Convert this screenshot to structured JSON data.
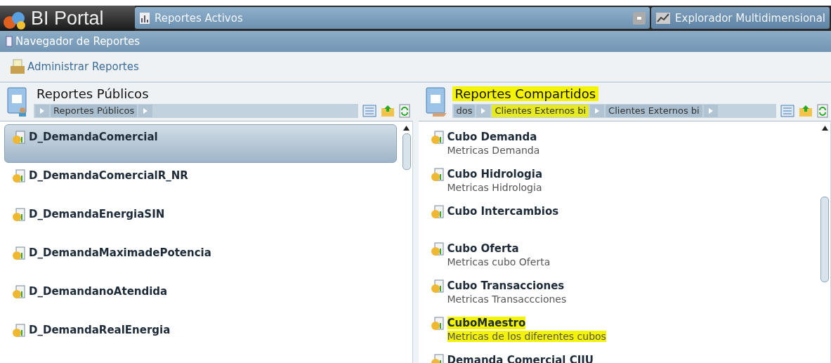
{
  "app": {
    "title": "BI Portal"
  },
  "tabs": [
    {
      "label": "Reportes Activos",
      "selected": true,
      "kind": "reports"
    },
    {
      "label": "Explorador Multidimensional",
      "selected": false,
      "kind": "explorer"
    }
  ],
  "navigator": {
    "title": "Navegador de Reportes"
  },
  "toolbar": {
    "label": "Administrar Reportes"
  },
  "public_panel": {
    "title": "Reportes Públicos",
    "highlighted": false,
    "breadcrumb": [
      {
        "label": "Reportes Públicos",
        "highlighted": false
      }
    ],
    "items": [
      {
        "name": "D_DemandaComercial",
        "selected": true
      },
      {
        "name": "D_DemandaComercialR_NR",
        "selected": false
      },
      {
        "name": "D_DemandaEnergiaSIN",
        "selected": false
      },
      {
        "name": "D_DemandaMaximadePotencia",
        "selected": false
      },
      {
        "name": "D_DemandanoAtendida",
        "selected": false
      },
      {
        "name": "D_DemandaRealEnergia",
        "selected": false
      }
    ]
  },
  "shared_panel": {
    "title": "Reportes Compartidos",
    "highlighted": true,
    "breadcrumb": [
      {
        "label": "dos",
        "highlighted": false
      },
      {
        "label": "Clientes Externos bi",
        "highlighted": true
      },
      {
        "label": "Clientes Externos bi",
        "highlighted": false
      }
    ],
    "items": [
      {
        "name": "Cubo Demanda",
        "description": "Metricas Demanda",
        "highlighted": false
      },
      {
        "name": "Cubo Hidrologia",
        "description": "Metricas Hidrologia",
        "highlighted": false
      },
      {
        "name": "Cubo Intercambios",
        "highlighted": false
      },
      {
        "name": "Cubo Oferta",
        "description": "Metricas cubo Oferta",
        "highlighted": false
      },
      {
        "name": "Cubo Transacciones",
        "description": "Metricas Transaccciones",
        "highlighted": false
      },
      {
        "name": "CuboMaestro",
        "description": "Metricas de los diferentes cubos",
        "highlighted": true
      },
      {
        "name": "Demanda Comercial CIIU",
        "highlighted": false
      }
    ]
  }
}
